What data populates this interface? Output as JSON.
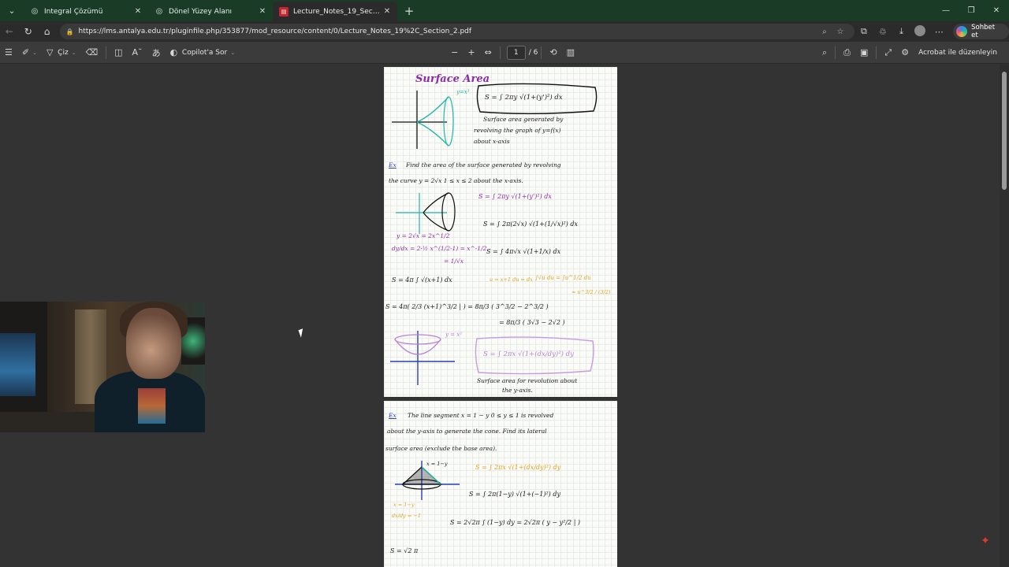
{
  "tabs": [
    {
      "label": "İntegral Çözümü",
      "icon": "globe-icon"
    },
    {
      "label": "Dönel Yüzey Alanı",
      "icon": "globe-icon"
    },
    {
      "label": "Lecture_Notes_19_Section_2.pdf",
      "icon": "pdf-icon",
      "active": true
    }
  ],
  "address": {
    "url": "https://lms.antalya.edu.tr/pluginfile.php/353877/mod_resource/content/0/Lecture_Notes_19%2C_Section_2.pdf"
  },
  "copilot_button": "Sohbet et",
  "pdf_toolbar": {
    "draw_label": "Çiz",
    "copilot_label": "Copilot'a Sor",
    "page_current": "1",
    "page_total": "/ 6",
    "edit_label": "Acrobat ile düzenleyin"
  },
  "page1": {
    "title": "Surface Area",
    "box_formula": "S = ∫ 2πy √(1+(y')²) dx",
    "y_eq_x3": "y=x³",
    "desc1": "Surface area generated by",
    "desc2": "revolving the graph of y=f(x)",
    "desc3": "about x-axis",
    "ex_label": "Ex",
    "ex_line1": "Find the area of the surface generated by revolving",
    "ex_line2": "the curve  y = 2√x       1 ≤ x ≤ 2   about the x-axis.",
    "f1": "S = ∫ 2πy √(1+(y')²) dx",
    "f2": "S = ∫ 2π(2√x) √(1+(1/√x)²) dx",
    "f3": "S = ∫ 4π√x √(1+1/x) dx",
    "f4": "y = 2√x = 2x^1/2",
    "f5": "dy/dx = 2·½ x^(1/2-1) = x^-1/2",
    "f6": "= 1/√x",
    "f7": "S = 4π ∫ √(x+1) dx",
    "f8": "u = x+1   du = dx",
    "f9": "∫√u du = ∫u^1/2 du",
    "f10": "= u^3/2 / (3/2)",
    "f11": "S = 4π( 2/3 (x+1)^3/2 | ) = 8π/3 ( 3^3/2 − 2^3/2 )",
    "f12": "= 8π/3 ( 3√3 − 2√2 )",
    "y_eq_x2": "y = x²",
    "box2": "S = ∫ 2πx √(1+(dx/dy)²) dy",
    "desc4": "Surface area for revolution about",
    "desc5": "the y-axis."
  },
  "page2": {
    "ex_label": "Ex",
    "line1": "The line segment  x = 1 − y   0 ≤ y ≤ 1  is revolved",
    "line2": "about the y-axis to generate the cone. Find its lateral",
    "line3": "surface area (exclude the base area).",
    "g1": "S = ∫ 2πx √(1+(dx/dy)²) dy",
    "x_eq": "x = 1−y",
    "g2": "S = ∫ 2π(1−y) √(1+(−1)²) dy",
    "g3": "x = 1−y",
    "g4": "dx/dy = −1",
    "g5": "S = 2√2π ∫ (1−y) dy = 2√2π ( y − y²/2 | )",
    "g6": "S = √2 π"
  },
  "colors": {
    "tabbar": "#1a3b26",
    "purple_ink": "#8b2aa6",
    "teal_ink": "#1fb7a5",
    "orange_ink": "#e2a21b",
    "blue_ink": "#2a3fb8"
  }
}
